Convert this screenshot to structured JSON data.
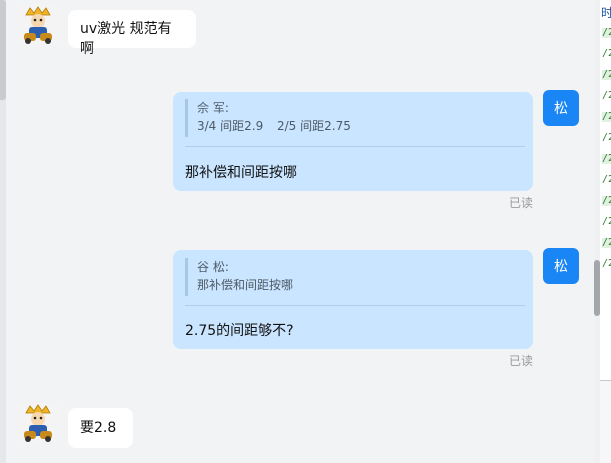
{
  "messages": [
    {
      "text": "uv激光 规范有啊"
    },
    {
      "avatar_label": "松",
      "quote": {
        "author": "佘 军:",
        "line1_a": "3/4 间距2.9",
        "line1_b": "2/5  间距2.75"
      },
      "text": "那补偿和间距按哪",
      "status": "已读"
    },
    {
      "avatar_label": "松",
      "quote": {
        "author": "谷 松:",
        "line1": "那补偿和间距按哪"
      },
      "text": "2.75的间距够不?",
      "status": "已读"
    },
    {
      "text": "要2.8"
    }
  ],
  "right_panel": {
    "top_text": "时",
    "lines": [
      "/2",
      "/2",
      "/2",
      "/2",
      "/2",
      "/2",
      "/2",
      "/2",
      "/2",
      "/2",
      "/2",
      "/2"
    ]
  },
  "colors": {
    "self_avatar": "#1a86f5",
    "self_bubble": "#c9e5ff",
    "other_bubble": "#ffffff",
    "background": "#f2f3f5"
  },
  "icons": {
    "other_avatar": "cartoon-character-avatar"
  }
}
